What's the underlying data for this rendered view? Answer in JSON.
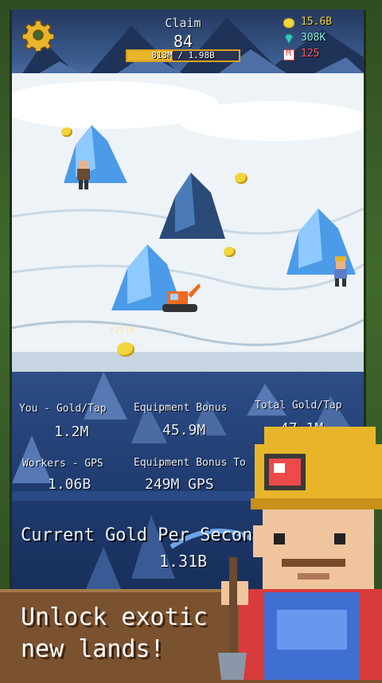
{
  "hud": {
    "claim_label": "Claim",
    "claim_number": "84",
    "claim_progress_text": "813M / 1.98B",
    "claim_progress_fraction": 0.41,
    "gold": "15.6B",
    "gems": "308K",
    "tickets": "125",
    "ticket_letter": "M"
  },
  "floating_text": "+251K",
  "stats": {
    "you_gold_tap_label": "You - Gold/Tap",
    "you_gold_tap_value": "1.2M",
    "equipment_bonus_label_1": "Equipment Bonus",
    "equipment_bonus_value_1": "45.9M",
    "total_gold_tap_label": "Total Gold/Tap",
    "total_gold_tap_value": "47.1M",
    "workers_gps_label": "Workers - GPS",
    "workers_gps_value": "1.06B",
    "equipment_bonus_label_2": "Equipment Bonus To",
    "equipment_bonus_value_2": "249M GPS",
    "current_gps_label": "Current Gold Per Secon",
    "current_gps_value": "1.31B"
  },
  "banner": {
    "line1": "Unlock exotic",
    "line2": "new lands!"
  },
  "colors": {
    "gold": "#f2d53a",
    "gem": "#33c9c0",
    "ticket": "#e03a3a",
    "banner": "#7b5230",
    "progress_border": "#d9a21f"
  },
  "icons": {
    "settings": "gear-icon",
    "gold": "gold-nugget-icon",
    "gems": "gem-icon",
    "tickets": "ticket-icon"
  }
}
